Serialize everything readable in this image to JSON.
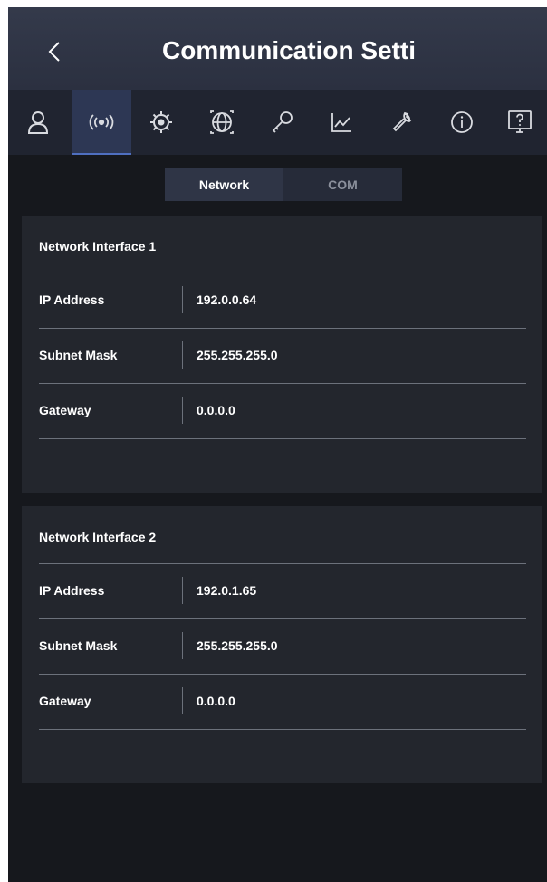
{
  "header": {
    "title": "Communication Setti",
    "back_icon": "chevron-left-icon"
  },
  "toolbar": {
    "icons": [
      "user-icon",
      "wireless-signal-icon",
      "gear-icon",
      "globe-icon",
      "key-icon",
      "line-chart-icon",
      "wrench-icon",
      "info-icon",
      "help-monitor-icon"
    ],
    "active_index": 1
  },
  "subtabs": [
    {
      "label": "Network",
      "active": true
    },
    {
      "label": "COM",
      "active": false
    }
  ],
  "interfaces": [
    {
      "title": "Network Interface 1",
      "rows": [
        {
          "label": "IP Address",
          "value": "192.0.0.64"
        },
        {
          "label": "Subnet Mask",
          "value": "255.255.255.0"
        },
        {
          "label": "Gateway",
          "value": "0.0.0.0"
        }
      ]
    },
    {
      "title": "Network Interface 2",
      "rows": [
        {
          "label": "IP Address",
          "value": "192.0.1.65"
        },
        {
          "label": "Subnet Mask",
          "value": "255.255.255.0"
        },
        {
          "label": "Gateway",
          "value": "0.0.0.0"
        }
      ]
    }
  ],
  "colors": {
    "background": "#16181d",
    "header": "#2f3546",
    "panel": "#23262d",
    "active_tab": "#2d3754",
    "text": "#ffffff"
  }
}
